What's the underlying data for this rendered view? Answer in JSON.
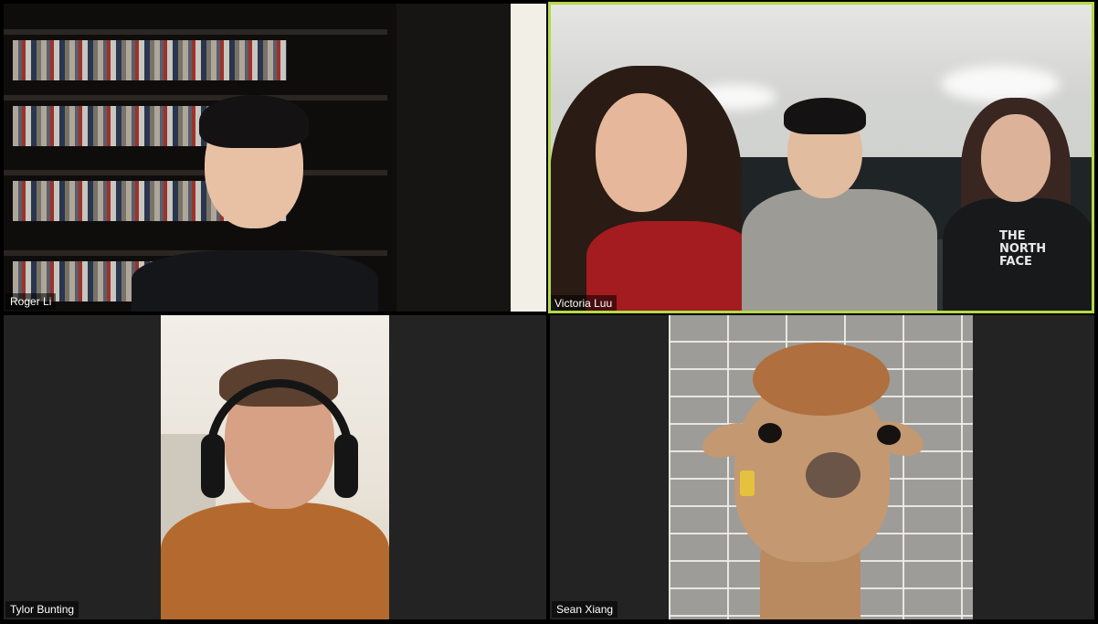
{
  "participants": [
    {
      "name": "Roger Li",
      "active_speaker": false
    },
    {
      "name": "Victoria Luu",
      "active_speaker": true
    },
    {
      "name": "Tylor Bunting",
      "active_speaker": false
    },
    {
      "name": "Sean Xiang",
      "active_speaker": false
    }
  ],
  "shirt_logo": "THE NORTH FACE",
  "colors": {
    "background": "#000000",
    "tile_background": "#232323",
    "active_speaker_border": "#b7d84a",
    "label_text": "#ffffff"
  }
}
